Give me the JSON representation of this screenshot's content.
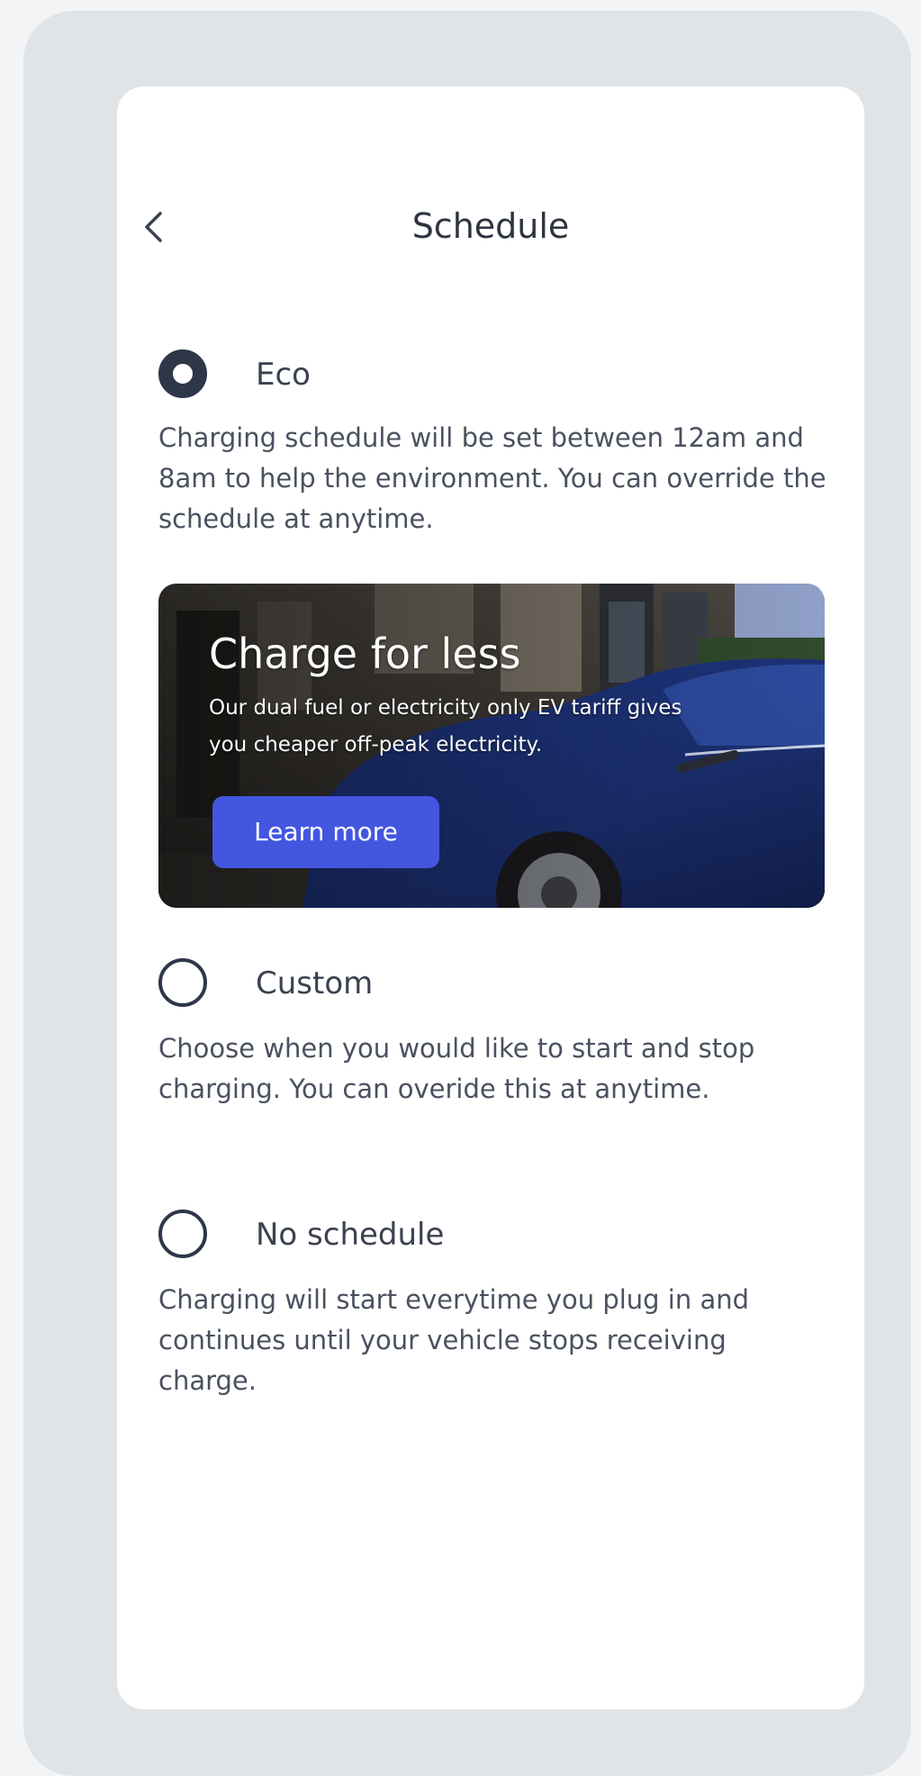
{
  "header": {
    "back_icon": "chevron-left-icon",
    "title": "Schedule"
  },
  "options": [
    {
      "label": "Eco",
      "selected": true,
      "description": "Charging schedule will be set between 12am and 8am to help the environment. You can override the schedule at anytime."
    },
    {
      "label": "Custom",
      "selected": false,
      "description": "Choose when you would like to start and stop charging. You can overide this at anytime."
    },
    {
      "label": "No schedule",
      "selected": false,
      "description": "Charging will start everytime you plug in and continues until your vehicle stops receiving charge."
    }
  ],
  "promo": {
    "title": "Charge for less",
    "subtitle": "Our dual fuel or electricity only EV tariff gives you cheaper off-peak electricity.",
    "button_label": "Learn more"
  },
  "colors": {
    "accent": "#4356e0",
    "radio": "#2e3748",
    "text": "#3a4150"
  }
}
